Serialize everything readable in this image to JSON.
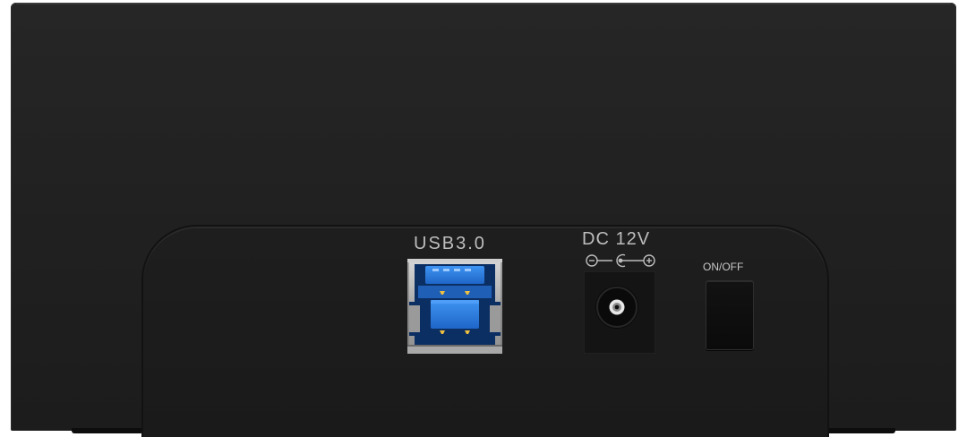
{
  "device": {
    "usb_label": "USB3.0",
    "dc_label": "DC 12V",
    "switch_label": "ON/OFF"
  },
  "icons": {
    "usb_port": "usb3-type-b-port-icon",
    "dc_jack": "dc-power-jack-icon",
    "polarity": "center-positive-polarity-icon",
    "switch": "rocker-switch-icon"
  },
  "colors": {
    "body": "#222222",
    "usb_blue": "#2f7fe0",
    "label_text": "#bdbdbd"
  }
}
